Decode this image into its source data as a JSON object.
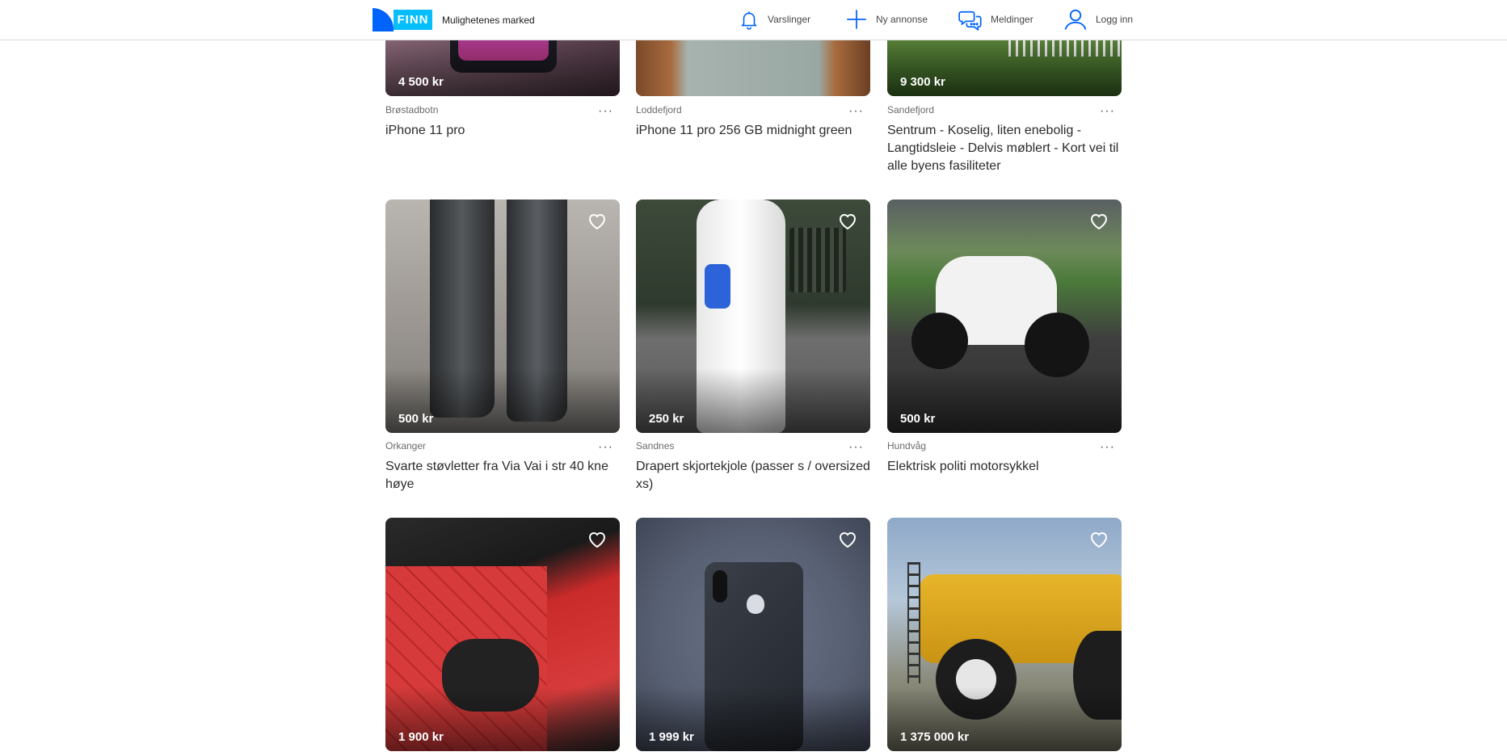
{
  "header": {
    "logo_text": "FINN",
    "tagline": "Mulighetenes marked",
    "nav": {
      "alerts": "Varslinger",
      "new_ad": "Ny annonse",
      "messages": "Meldinger",
      "login": "Logg inn"
    },
    "icons": {
      "alerts": "bell-icon",
      "new_ad": "plus-icon",
      "messages": "chat-bubbles-icon",
      "login": "user-icon"
    }
  },
  "colors": {
    "brand_dark": "#0063fb",
    "brand_light": "#06befb",
    "icon": "#0063fb"
  },
  "listings": [
    {
      "location": "Brøstadbotn",
      "title": "iPhone 11 pro",
      "price": "4 500 kr"
    },
    {
      "location": "Loddefjord",
      "title": "iPhone 11 pro 256 GB midnight green",
      "price": ""
    },
    {
      "location": "Sandefjord",
      "title": "Sentrum - Koselig, liten enebolig - Langtidsleie - Delvis møblert - Kort vei til alle byens fasiliteter",
      "price": "9 300 kr"
    },
    {
      "location": "Orkanger",
      "title": "Svarte støvletter fra Via Vai i str 40 kne høye",
      "price": "500 kr"
    },
    {
      "location": "Sandnes",
      "title": "Drapert skjortekjole (passer s / oversized xs)",
      "price": "250 kr"
    },
    {
      "location": "Hundvåg",
      "title": "Elektrisk politi motorsykkel",
      "price": "500 kr"
    },
    {
      "location": "",
      "title": "",
      "price": "1 900 kr"
    },
    {
      "location": "",
      "title": "",
      "price": "1 999 kr"
    },
    {
      "location": "",
      "title": "",
      "price": "1 375 000 kr"
    }
  ],
  "more_options_label": "···"
}
